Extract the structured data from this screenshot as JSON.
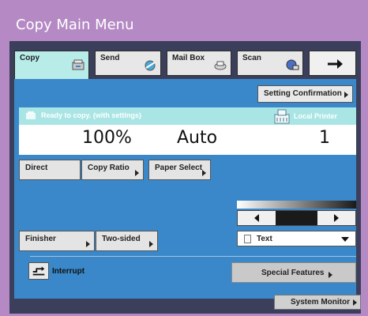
{
  "window": {
    "title": "Copy Main Menu"
  },
  "tabs": [
    {
      "label": "Copy",
      "icon": "copier-icon",
      "active": true
    },
    {
      "label": "Send",
      "icon": "send-icon",
      "active": false
    },
    {
      "label": "Mail Box",
      "icon": "mailbox-icon",
      "active": false
    },
    {
      "label": "Scan",
      "icon": "scan-icon",
      "active": false
    },
    {
      "label": "",
      "icon": "arrow-right-icon",
      "active": false
    }
  ],
  "setting_confirmation": {
    "label": "Setting Confirmation"
  },
  "status": {
    "message": "Ready to copy. (with settings)",
    "printer_label": "Local Printer"
  },
  "readout": {
    "ratio": "100%",
    "paper": "Auto",
    "quantity": "1"
  },
  "buttons": {
    "direct": "Direct",
    "copy_ratio": "Copy Ratio",
    "paper_select": "Paper Select",
    "finisher": "Finisher",
    "two_sided": "Two-sided",
    "special_features": "Special Features",
    "system_monitor": "System Monitor"
  },
  "density": {
    "mode_selected": "Text"
  },
  "interrupt": {
    "label": "Interrupt"
  },
  "colors": {
    "frame": "#b489c4",
    "screen": "#3b3f5b",
    "panel": "#3a88c9",
    "status_bar": "#a9e5e4",
    "active_tab": "#b7ece8"
  }
}
